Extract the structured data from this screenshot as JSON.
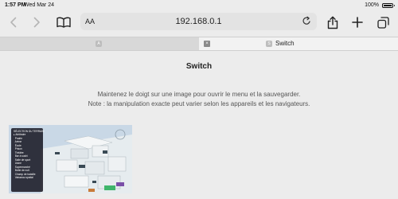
{
  "status_bar": {
    "time": "1:57 PM",
    "date": "Wed Mar 24",
    "battery": "100%"
  },
  "toolbar": {
    "address_aa": "AA",
    "url": "192.168.0.1"
  },
  "tabs": [
    {
      "label": "",
      "favicon": "A",
      "active": false
    },
    {
      "label": "Switch",
      "favicon": "S",
      "active": true
    }
  ],
  "page": {
    "title": "Switch",
    "note_line1": "Maintenez le doigt sur une image pour ouvrir le menu et la sauvegarder.",
    "note_line2": "Note : la manipulation exacte peut varier selon les appareils et les navigateurs."
  },
  "game_menu": {
    "title": "SÉLECTION DU TERRAIN",
    "items": [
      "Arbitraire",
      "Prairie",
      "Arène",
      "École",
      "Prison",
      "Théâtre",
      "Bar à sushi",
      "Salle de sport",
      "Usine",
      "Supermarché",
      "Boîte de nuit",
      "Champ de bataille",
      "Vaisseau spatial"
    ]
  },
  "colors": {
    "background": "#ececec",
    "address_bar": "#e3e3e3"
  }
}
